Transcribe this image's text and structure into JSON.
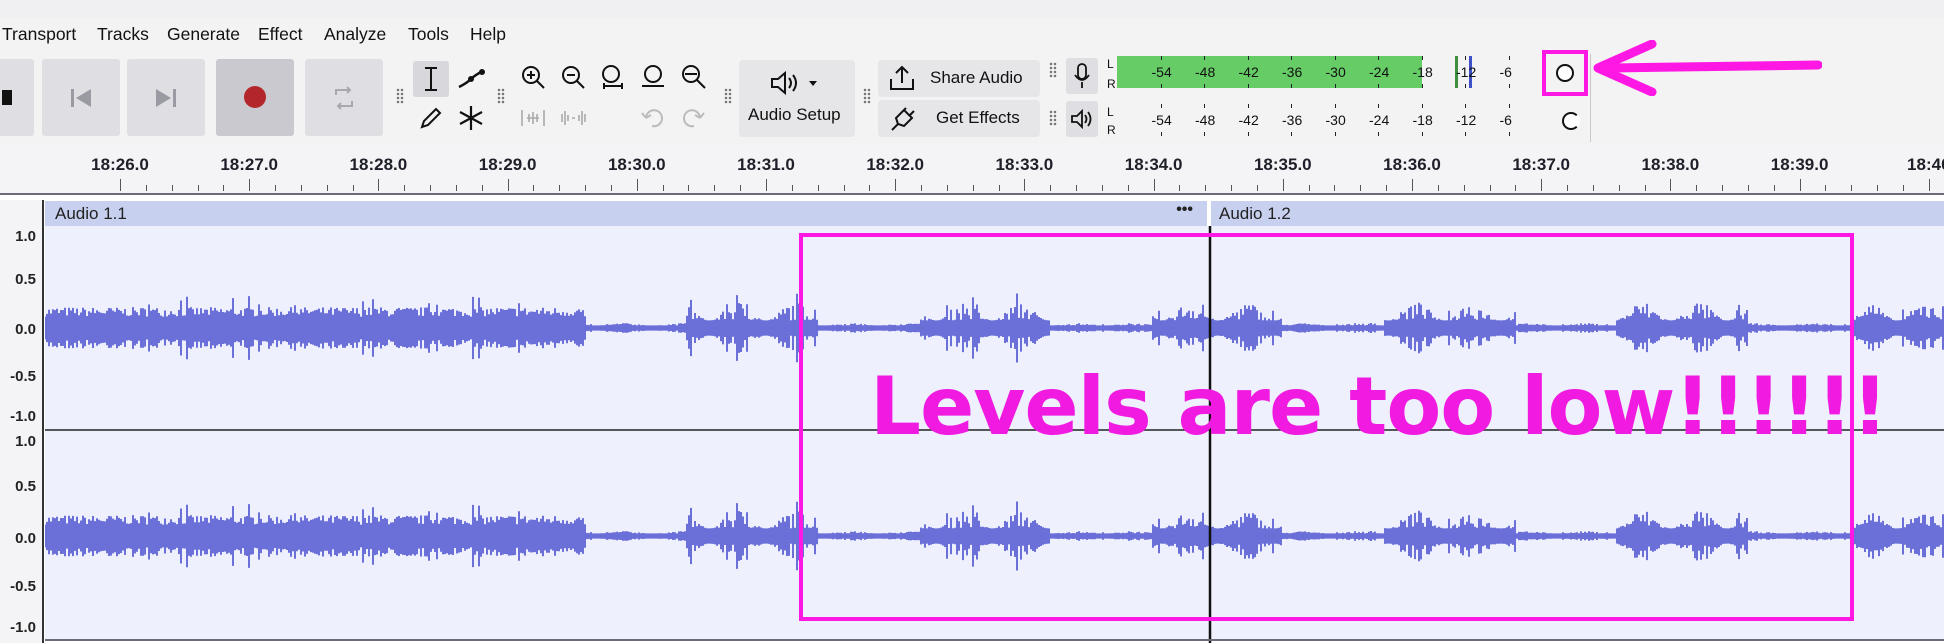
{
  "menu": {
    "items": [
      "Transport",
      "Tracks",
      "Generate",
      "Effect",
      "Analyze",
      "Tools",
      "Help"
    ]
  },
  "toolbar": {
    "share_audio_label": "Share Audio",
    "get_effects_label": "Get Effects",
    "audio_setup_label": "Audio Setup"
  },
  "meters": {
    "recording": {
      "channel_left": "L",
      "channel_right": "R",
      "scale": [
        "-54",
        "-48",
        "-42",
        "-36",
        "-30",
        "-24",
        "-18",
        "-12",
        "-6"
      ],
      "level_db": -18,
      "peak_db": -12,
      "level_color": "#66cc66"
    },
    "playback": {
      "channel_left": "L",
      "channel_right": "R",
      "scale": [
        "-54",
        "-48",
        "-42",
        "-36",
        "-30",
        "-24",
        "-18",
        "-12",
        "-6"
      ]
    }
  },
  "timeline": {
    "ticks": [
      "18:26.0",
      "18:27.0",
      "18:28.0",
      "18:29.0",
      "18:30.0",
      "18:31.0",
      "18:32.0",
      "18:33.0",
      "18:34.0",
      "18:35.0",
      "18:36.0",
      "18:37.0",
      "18:38.0",
      "18:39.0",
      "18:40"
    ]
  },
  "tracks": {
    "clips": [
      {
        "name": "Audio 1.1"
      },
      {
        "name": "Audio 1.2"
      }
    ],
    "clip_menu": "•••",
    "amplitude_labels": [
      "1.0",
      "0.5",
      "0.0",
      "-0.5",
      "-1.0"
    ],
    "waveform_color": "#6b6fd8"
  },
  "annotation": {
    "text": "Levels are too low!!!!!!",
    "color": "#ff17e3"
  }
}
